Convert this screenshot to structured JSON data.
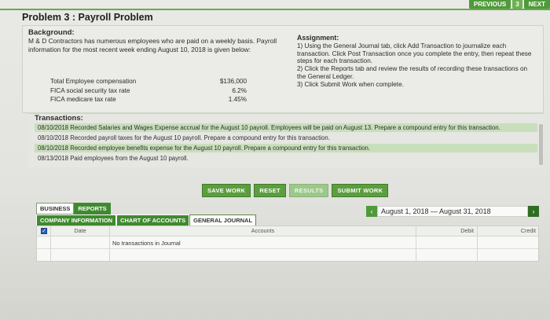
{
  "nav": {
    "previous": "PREVIOUS",
    "page": "3",
    "next": "NEXT"
  },
  "title": "Problem 3 : Payroll Problem",
  "background": {
    "heading": "Background:",
    "text": "M & D Contractors has numerous employees who are paid on a weekly basis. Payroll information for the most recent week ending August 10, 2018 is given below:",
    "rows": [
      {
        "label": "Total Employee compensation",
        "value": "$136,000"
      },
      {
        "label": "FICA social security tax rate",
        "value": "6.2%"
      },
      {
        "label": "FICA medicare tax rate",
        "value": "1.45%"
      }
    ]
  },
  "assignment": {
    "heading": "Assignment:",
    "lines": [
      "1) Using the General Journal tab, click Add Transaction to journalize each transaction. Click Post Transaction once you complete the entry, then repeat these steps for each transaction.",
      "2) Click the Reports tab and review the results of recording these transactions on the General Ledger.",
      "3) Click Submit Work when complete."
    ]
  },
  "transactions": {
    "heading": "Transactions:",
    "items": [
      "08/10/2018  Recorded Salaries and Wages Expense accrual for the August 10 payroll. Employees will be paid on August 13. Prepare a compound entry for this transaction.",
      "08/10/2018 Recorded payroll taxes for the August 10 payroll. Prepare a compound entry for this transaction.",
      "08/10/2018 Recorded employee benefits expense for the August 10 payroll. Prepare a compound entry for this transaction.",
      "08/13/2018 Paid employees from the August 10 payroll."
    ]
  },
  "buttons": {
    "save": "SAVE WORK",
    "reset": "RESET",
    "results": "RESULTS",
    "submit": "SUBMIT WORK"
  },
  "tabs": {
    "top": [
      "BUSINESS",
      "REPORTS"
    ],
    "bottom": [
      "COMPANY INFORMATION",
      "CHART OF ACCOUNTS",
      "GENERAL JOURNAL"
    ]
  },
  "date_range": "August 1, 2018 — August 31, 2018",
  "journal": {
    "columns": {
      "date": "Date",
      "accounts": "Accounts",
      "debit": "Debit",
      "credit": "Credit"
    },
    "empty_text": "No transactions in Journal"
  },
  "colors": {
    "accent": "#4f9a3a",
    "highlight": "#c8dfbb",
    "checkbox": "#2c5bb3"
  }
}
